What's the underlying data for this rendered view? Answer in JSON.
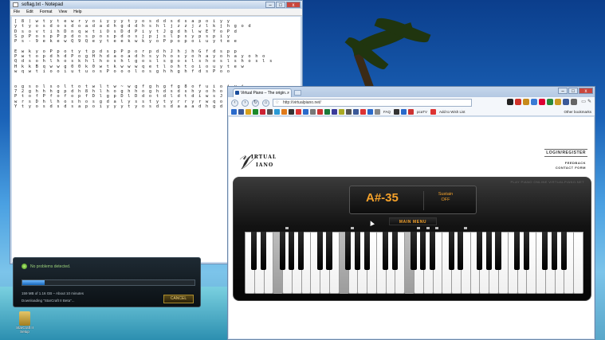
{
  "notepad": {
    "title": "soflag.txt - Notepad",
    "menu": [
      "File",
      "Edit",
      "Format",
      "View",
      "Help"
    ],
    "controls": {
      "minimize": "–",
      "maximize": "□",
      "close": "x"
    },
    "lines": [
      "[ 8 ( w t y t e w r y o i y y y t y o s d d s d s a p o i y y",
      "y t y o s d o s d o a d a d h g d d h s h l j z z j z l k j h g o d",
      "D s o v t i h D n q w t i O s D d P i y t J g d h l w E Y o P d",
      "S p P o s p P p d o s p o s p d o s j p j s l p s y p s p i y",
      "P s - 9 e k e w Q 9 Q e y t e e k w k y o P p o p o i u y t e e",
      "",
      "E w k y o P p o t y t p d s p P p o r p d h J h j h G f d s p p",
      "P w t o p d h d P o g H h d a o a d h s y h o s y o h a y o h a y o h o",
      "Q d s o h l h o s k h l h o s h l g o s l s g o s l s h o s l s h o s l s",
      "H k k B q w w g 0 0 k 0 w t k w w w q e t l o h t o i o u y t e w",
      "w q w t i o o i u t u o s P o o o l o s g h h g h f d s P o o",
      "",
      "",
      "o g s o l s o l t o t w l t w ~ w g f g h g f g 8 o f u i o i u i",
      "7 2 g h h h g p d h 8 h l h o g h h o g h d s d s h y o h o y a g o y a o g o",
      "P t o f P f o f o p f D l g p D l D d o t d l d t d i w s J S h s S 2 S w t y s y",
      "w r s D h l h o s h o s g d a l y s s t y t y r r y r w q o i y",
      "Y t y o s d s d s a p o i y y y t y o s d s d a a a d h g d d h s d h l s z k"
    ]
  },
  "download": {
    "status": "No problems detected.",
    "progress": 0.13,
    "time_remaining": "159 MB of 1.16 GB – About 10 minutes",
    "filename": "Downloading \"StarCraft II Beta\"...",
    "cancel_label": "CANCEL"
  },
  "desktop_icon": {
    "label": "StarCraft II Setup",
    "icon": "folder-icon"
  },
  "browser": {
    "tab_title": "Virtual Piano – The origin...",
    "tab_close": "×",
    "url": "http://virtualpiano.net/",
    "nav": {
      "back": "‹",
      "forward": "›",
      "reload": "↻",
      "home": "⌂"
    },
    "controls": {
      "minimize": "–",
      "maximize": "□",
      "close": "x"
    },
    "bookmarks": {
      "faq_label": "FAQ",
      "pcatv_label": "pcaTV",
      "wishlist_label": "Add to Wish List",
      "other_label": "Other bookmarks"
    },
    "page": {
      "logo_top": "IRTUAL",
      "logo_bottom": "IANO",
      "login": "LOGIN/REGISTER",
      "feedback": "FEEDBACK",
      "contact": "CONTACT FORM",
      "tagline": "PLAY PIANO ONLINE VIRTUALPIANO.NET",
      "current_note": "A#-35",
      "sustain_label": "Sustain",
      "sustain_value": "OFF",
      "main_menu": "MAIN MENU"
    }
  }
}
